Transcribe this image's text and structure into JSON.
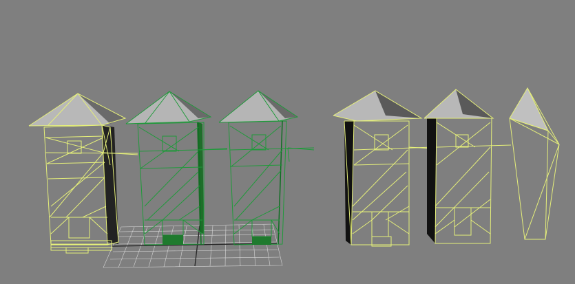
{
  "viewport": {
    "name": "3d-viewport",
    "background": "#7f7f7f",
    "wire_colors": {
      "unselected": "#e6f07a",
      "selected": "#1f9a3a"
    }
  },
  "objects": [
    {
      "name": "tower-lod0-left",
      "state": "unselected"
    },
    {
      "name": "tower-lod0-center",
      "state": "selected"
    },
    {
      "name": "tower-lod1",
      "state": "selected"
    },
    {
      "name": "tower-lod2",
      "state": "unselected"
    },
    {
      "name": "tower-lod3",
      "state": "unselected"
    },
    {
      "name": "tower-lod4",
      "state": "unselected"
    }
  ]
}
